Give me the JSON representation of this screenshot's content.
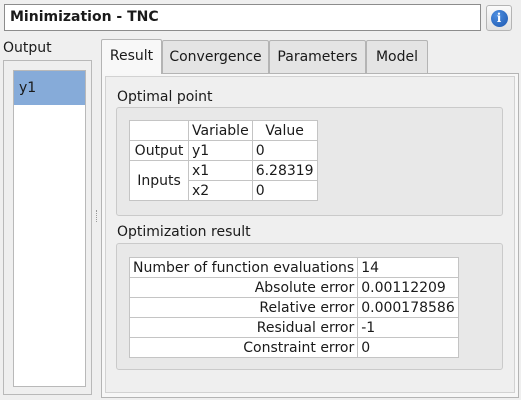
{
  "window": {
    "title": "Minimization - TNC"
  },
  "sidebar": {
    "label": "Output",
    "items": [
      {
        "label": "y1",
        "selected": true
      }
    ]
  },
  "tabs": [
    {
      "label": "Result",
      "active": true
    },
    {
      "label": "Convergence",
      "active": false
    },
    {
      "label": "Parameters",
      "active": false
    },
    {
      "label": "Model",
      "active": false
    }
  ],
  "optimal_point": {
    "title": "Optimal point",
    "headers": [
      "Variable",
      "Value"
    ],
    "output_label": "Output",
    "inputs_label": "Inputs",
    "output_row": {
      "variable": "y1",
      "value": "0"
    },
    "input_rows": [
      {
        "variable": "x1",
        "value": "6.28319"
      },
      {
        "variable": "x2",
        "value": "0"
      }
    ]
  },
  "optimization_result": {
    "title": "Optimization result",
    "rows": [
      {
        "label": "Number of function evaluations",
        "value": "14"
      },
      {
        "label": "Absolute error",
        "value": "0.00112209"
      },
      {
        "label": "Relative error",
        "value": "0.000178586"
      },
      {
        "label": "Residual error",
        "value": "-1"
      },
      {
        "label": "Constraint error",
        "value": "0"
      }
    ]
  },
  "colors": {
    "selection": "#86abd9",
    "info_icon": "#1d58b0"
  },
  "icons": {
    "info": "info-icon"
  }
}
